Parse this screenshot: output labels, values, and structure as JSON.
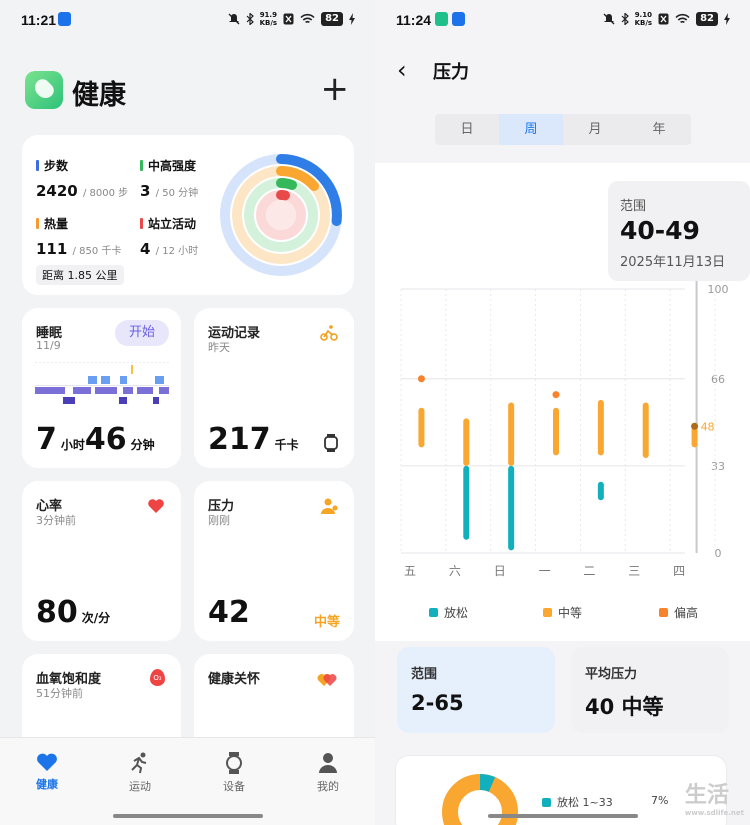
{
  "left": {
    "status": {
      "time": "11:21",
      "speed_top": "91.9",
      "speed_unit": "KB/s",
      "battery": "82"
    },
    "header": {
      "title": "健康",
      "add_icon": "plus-icon"
    },
    "summary": {
      "steps": {
        "label": "步数",
        "value": "2420",
        "goal": "/ 8000 步",
        "color": "#3b6fe0"
      },
      "intensity": {
        "label": "中高强度",
        "value": "3",
        "goal": "/ 50 分钟",
        "color": "#35b85a"
      },
      "calories": {
        "label": "热量",
        "value": "111",
        "goal": "/ 850 千卡",
        "color": "#f59b2d"
      },
      "stand": {
        "label": "站立活动",
        "value": "4",
        "goal": "/ 12 小时",
        "color": "#e84a4a"
      },
      "distance": "距离 1.85 公里"
    },
    "sleep": {
      "title": "睡眠",
      "date": "11/9",
      "start": "开始",
      "hours": "7",
      "hours_unit": "小时",
      "minutes": "46",
      "minutes_unit": "分钟"
    },
    "workout": {
      "title": "运动记录",
      "sub": "昨天",
      "value": "217",
      "unit": "千卡"
    },
    "heart": {
      "title": "心率",
      "sub": "3分钟前",
      "value": "80",
      "unit": "次/分"
    },
    "stress": {
      "title": "压力",
      "sub": "刚刚",
      "value": "42",
      "level": "中等"
    },
    "spo2": {
      "title": "血氧饱和度",
      "sub": "51分钟前",
      "o2": "O₂"
    },
    "care": {
      "title": "健康关怀"
    },
    "nav": [
      {
        "label": "健康",
        "icon": "heart-icon"
      },
      {
        "label": "运动",
        "icon": "runner-icon"
      },
      {
        "label": "设备",
        "icon": "watch-icon"
      },
      {
        "label": "我的",
        "icon": "person-icon"
      }
    ]
  },
  "right": {
    "status": {
      "time": "11:24",
      "speed_top": "9.10",
      "speed_unit": "KB/s",
      "battery": "82"
    },
    "title": "压力",
    "tabs": [
      "日",
      "周",
      "月",
      "年"
    ],
    "active_tab": "周",
    "tooltip": {
      "label": "范围",
      "range": "40-49",
      "date": "2025年11月13日"
    },
    "chart_data": {
      "type": "range-bar",
      "categories": [
        "五",
        "六",
        "日",
        "一",
        "二",
        "三",
        "四"
      ],
      "y_ticks": [
        "100",
        "66",
        "33",
        "0"
      ],
      "ylim": [
        0,
        100
      ],
      "series": [
        {
          "name": "放松",
          "color": "#12b0bc",
          "ranges": [
            [],
            [
              5,
              33
            ],
            [
              1,
              33
            ],
            [],
            [
              20,
              27
            ],
            [],
            []
          ]
        },
        {
          "name": "中等",
          "color": "#f9a731",
          "ranges": [
            [
              40,
              55
            ],
            [
              33,
              51
            ],
            [
              33,
              57
            ],
            [
              37,
              55
            ],
            [
              37,
              58
            ],
            [
              36,
              57
            ],
            [
              40,
              49
            ]
          ]
        },
        {
          "name": "偏高",
          "color": "#f7832c",
          "ranges": [
            [
              66,
              66
            ],
            [],
            [],
            [
              60,
              60
            ],
            [],
            [],
            []
          ]
        }
      ],
      "selected_category": "四",
      "selected_value": "48"
    },
    "stats": {
      "range_label": "范围",
      "range_value": "2-65",
      "avg_label": "平均压力",
      "avg_value": "40 中等"
    },
    "distribution": {
      "relax_label": "放松 1~33",
      "relax_pct": "7%"
    }
  },
  "watermark": {
    "text": "生活",
    "sub": "www.sdlife.net"
  }
}
